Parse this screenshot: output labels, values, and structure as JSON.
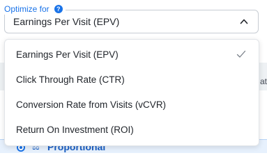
{
  "field": {
    "label": "Optimize for",
    "help_icon_glyph": "?",
    "selected_value": "Earnings Per Visit (EPV)"
  },
  "dropdown": {
    "options": [
      {
        "label": "Earnings Per Visit (EPV)",
        "selected": true
      },
      {
        "label": "Click Through Rate (CTR)",
        "selected": false
      },
      {
        "label": "Conversion Rate from Visits (vCVR)",
        "selected": false
      },
      {
        "label": "Return On Investment (ROI)",
        "selected": false
      }
    ]
  },
  "background": {
    "partial_text": "at",
    "proportional_label": "Proportional"
  },
  "colors": {
    "accent": "#1a73e8",
    "text": "#1f2329",
    "border": "#c7ccd3"
  },
  "icons": {
    "help": "question-circle-icon",
    "chevron": "chevron-up-icon",
    "check": "check-icon",
    "radio": "radio-selected-icon",
    "scale": "balance-scale-icon"
  }
}
